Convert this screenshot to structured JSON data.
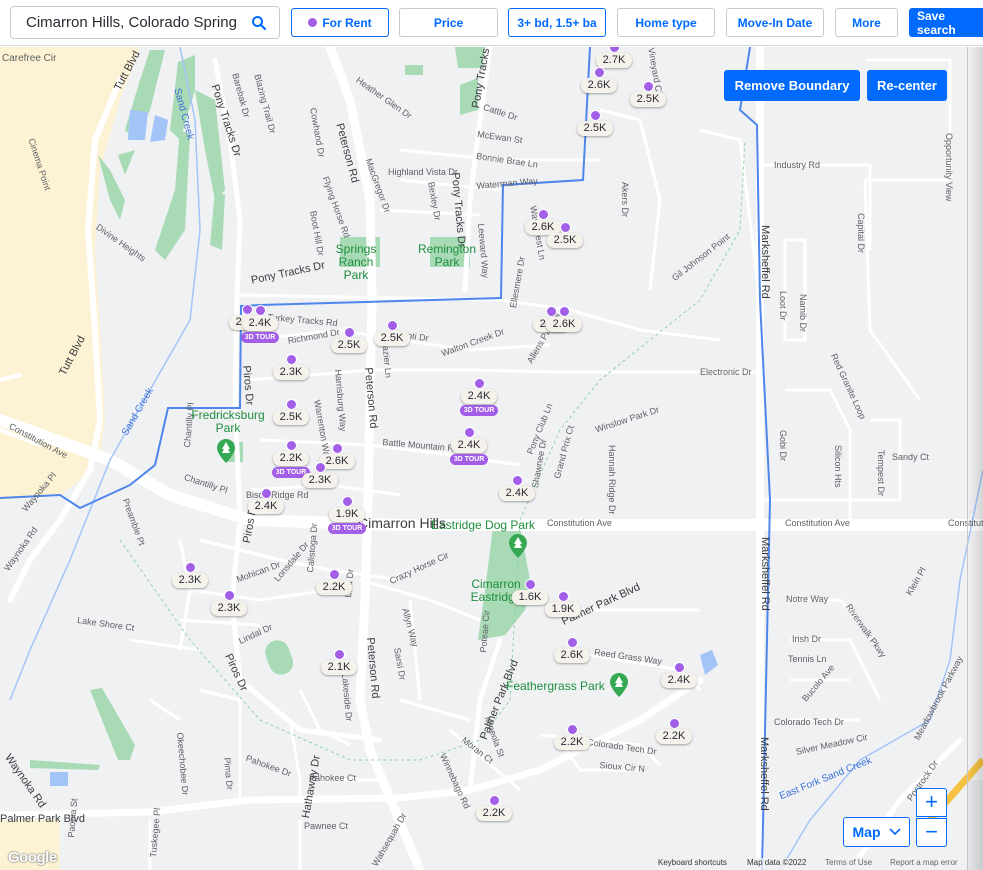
{
  "search": {
    "value": "Cimarron Hills, Colorado Spring",
    "icon": "search-icon"
  },
  "filters": [
    {
      "label": "For Rent",
      "has_dot": true,
      "active": true
    },
    {
      "label": "Price",
      "active": false
    },
    {
      "label": "3+ bd, 1.5+ ba",
      "active": true
    },
    {
      "label": "Home type",
      "active": false
    },
    {
      "label": "Move-In Date",
      "active": false
    },
    {
      "label": "More",
      "active": false
    }
  ],
  "save_search_label": "Save search",
  "map_controls": {
    "remove_boundary": "Remove Boundary",
    "recenter": "Re-center",
    "map_type": "Map",
    "zoom_in": "+",
    "zoom_out": "−"
  },
  "attribution": {
    "keyboard": "Keyboard shortcuts",
    "map_data": "Map data ©2022",
    "terms": "Terms of Use",
    "report": "Report a map error",
    "logo": "Google"
  },
  "colors": {
    "accent": "#006aff",
    "marker": "#a35ee8",
    "park": "#1e8e3e",
    "boundary": "#4f86ec"
  },
  "listings": [
    {
      "price": "2.7K",
      "tour": false
    },
    {
      "price": "2.6K",
      "tour": false
    },
    {
      "price": "2.5K",
      "tour": false
    },
    {
      "price": "2.5K",
      "tour": false
    },
    {
      "price": "2.6K",
      "tour": false
    },
    {
      "price": "2.5K",
      "tour": false
    },
    {
      "price": "2.?K",
      "tour": false
    },
    {
      "price": "2.4K",
      "tour": true,
      "tour_label": "3D TOUR"
    },
    {
      "price": "2.5K",
      "tour": false
    },
    {
      "price": "2.5K",
      "tour": false
    },
    {
      "price": "2.?K",
      "tour": false
    },
    {
      "price": "2.6K",
      "tour": false
    },
    {
      "price": "2.3K",
      "tour": false
    },
    {
      "price": "2.4K",
      "tour": true,
      "tour_label": "3D TOUR"
    },
    {
      "price": "2.5K",
      "tour": false
    },
    {
      "price": "2.4K",
      "tour": true,
      "tour_label": "3D TOUR"
    },
    {
      "price": "2.2K",
      "tour": true,
      "tour_label": "3D TOUR"
    },
    {
      "price": "2.6K",
      "tour": false
    },
    {
      "price": "2.3K",
      "tour": false
    },
    {
      "price": "2.4K",
      "tour": false
    },
    {
      "price": "2.4K",
      "tour": false
    },
    {
      "price": "1.9K",
      "tour": true,
      "tour_label": "3D TOUR"
    },
    {
      "price": "2.3K",
      "tour": false
    },
    {
      "price": "2.3K",
      "tour": false
    },
    {
      "price": "2.2K",
      "tour": false
    },
    {
      "price": "2.1K",
      "tour": false
    },
    {
      "price": "1.6K",
      "tour": false
    },
    {
      "price": "1.9K",
      "tour": false
    },
    {
      "price": "2.6K",
      "tour": false
    },
    {
      "price": "2.4K",
      "tour": false
    },
    {
      "price": "2.2K",
      "tour": false
    },
    {
      "price": "2.2K",
      "tour": false
    },
    {
      "price": "2.2K",
      "tour": false
    }
  ],
  "map_labels": {
    "streets": [
      "Carefree Cir",
      "Tutt Blvd",
      "Cinema Point",
      "Divine Heights",
      "Pony Tracks Dr",
      "Barebak Dr",
      "Blazing Trail Dr",
      "Cowhand Dr",
      "Peterson Rd",
      "Heather Glen Dr",
      "MacGregor Dr",
      "Highland Vista Dr",
      "Bexley Dr",
      "Flying Horse Rd",
      "Boot Hill Dr",
      "Cattle Dr",
      "McEwan St",
      "Bonnie Brae Ln",
      "Waterman Way",
      "Leeward Way",
      "Wavecrest Ln",
      "Akers Dr",
      "Vineyard Cir",
      "Industry Rd",
      "Opportunity View",
      "Capital Dr",
      "Marksheffel Rd",
      "Loot Dr",
      "Namib Dr",
      "Gil Johnson Point",
      "Ellesmere Dr",
      "Turkey Tracks Rd",
      "Richmond Dr",
      "Frazier Ln",
      "Leoti Dr",
      "Walton Creek Dr",
      "Allens Park Dr",
      "Electronic Dr",
      "Red Granite Loop",
      "Piros Dr",
      "Harrisburg Way",
      "Warrenton Way",
      "Battle Mountain Rd",
      "Pony Club Ln",
      "Shawnee Dr",
      "Grand Prix Ct",
      "Winslow Park Dr",
      "Hannah Ridge Dr",
      "Gobi Dr",
      "Silicon Hts",
      "Tempest Dr",
      "Sandy Ct",
      "Constitution Ave",
      "Chantilly Pl",
      "Bison Ridge Rd",
      "Preamble Pt",
      "Waynoka Pl",
      "Waynoka Rd",
      "Mohican Dr",
      "Lonsdale Dr",
      "Calistoga Dr",
      "Lisa Dr",
      "Crazy Horse Cir",
      "Allyn Way",
      "Sarsi Dr",
      "Lake Shore Ct",
      "Lindal Dr",
      "Notre Way",
      "Riverwalk Pkwy",
      "Klein Pl",
      "Irish Dr",
      "Tennis Ln",
      "Bucolo Ave",
      "Colorado Tech Dr",
      "Silver Meadow Cir",
      "Reed Grass Way",
      "Palmer Park Blvd",
      "Poteae Cir",
      "Sioux Cir N",
      "Meadowbrook Parkway",
      "Postrock Dr",
      "Okeechobee Dr",
      "Pima Dr",
      "Pahokee Dr",
      "Pahokee Ct",
      "Mineola St",
      "Moran Ct",
      "Winnebago Rd",
      "Pawnee Ct",
      "Hathaway Dr",
      "Paonia St",
      "Tuskegee Pl",
      "Wahsequah Dr",
      "Lakeside Dr"
    ],
    "parks": [
      "Springs Ranch Park",
      "Remington Park",
      "Fredricksburg Park",
      "Eastridge Dog Park",
      "Cimarron Eastridge",
      "Feathergrass Park"
    ],
    "water": [
      "Sand Creek",
      "Sand Creek",
      "East Fork Sand Creek"
    ],
    "city": "Cimarron Hills"
  }
}
